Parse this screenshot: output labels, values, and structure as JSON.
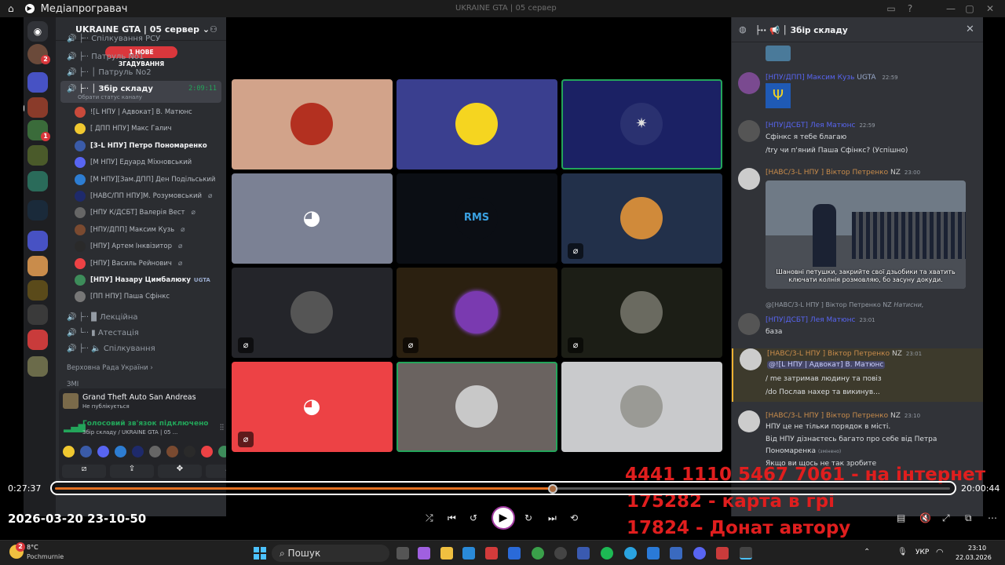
{
  "player": {
    "title": "Медіапрогравач",
    "center_title": "UKRAINE GTA | 05 сервер",
    "time_elapsed": "0:27:37",
    "time_total": "20:00:44",
    "progress": 0.5577,
    "timestamp_overlay": "2026-03-20 23-10-50"
  },
  "server": {
    "name": "UKRAINE GTA | 05 сервер",
    "mention_badge": "1 НОВЕ ЗГАДУВАННЯ",
    "channels_top": [
      {
        "label": "Спілкування РСУ"
      },
      {
        "label": "Патруль No1"
      },
      {
        "label": "Патруль No2"
      }
    ],
    "active_channel": {
      "label": "Збір складу",
      "status": "Обрати статус каналу",
      "timer": "2:09:11"
    },
    "voice_users": [
      {
        "name": "![L НПУ | Адвокат] В. Матюнс",
        "color": "#c94a3b"
      },
      {
        "name": "[ ДПП НПУ] Макс Галич",
        "color": "#f0c830"
      },
      {
        "name": "[3-L НПУ] Петро Пономаренко",
        "color": "#3a5ba8",
        "bold": true
      },
      {
        "name": "[М НПУ] Едуард Міхновський",
        "color": "#5865f2"
      },
      {
        "name": "[М НПУ][Зам.ДПП] Ден Подільський",
        "color": "#2d7dd2"
      },
      {
        "name": "[НАВС/ПП НПУ]М. Розумовський",
        "color": "#1e2a6b"
      },
      {
        "name": "[НПУ К/ДСБТ] Валерія Вест",
        "color": "#666666"
      },
      {
        "name": "[НПУ/ДПП] Максим Кузь",
        "color": "#7a4a30"
      },
      {
        "name": "[НПУ] Артем Інквізитор",
        "color": "#2a2a2a"
      },
      {
        "name": "[НПУ] Василь Рейнович",
        "color": "#ed4245"
      },
      {
        "name": "[НПУ] Назару Цимбалюку",
        "color": "#3d8c5a",
        "bold": true
      },
      {
        "name": "[ПП НПУ] Паша Сфінкс",
        "color": "#777777"
      }
    ],
    "channels_bottom": [
      {
        "label": "Лекційна"
      },
      {
        "label": "Атестація"
      },
      {
        "label": "Спілкування"
      }
    ],
    "categories": [
      {
        "label": "Верховна Рада України"
      },
      {
        "label": "ЗМІ"
      }
    ],
    "ugta_tag": "UGTA"
  },
  "activity": {
    "game": "Grand Theft Auto San Andreas",
    "sub": "Не публікується"
  },
  "voice_panel": {
    "status": "Голосовий зв'язок підключено",
    "channel": "Збір складу / UKRAINE GTA | 05 ..."
  },
  "chat": {
    "header": "Збір складу",
    "messages": [
      {
        "author": "[НПУ/ДПП] Максим Кузь",
        "tag": "UGTA",
        "time": "22:59",
        "lines": []
      },
      {
        "author": "[НПУ|ДСБТ] Лея Матюнс",
        "time": "22:59",
        "lines": [
          "Сфінкс я тебе благаю",
          "/try чи п'яний Паша Сфінкс? (Успішно)"
        ]
      },
      {
        "author": "[НАВС/3-L НПУ ] Віктор Петренко",
        "tag": "NZ",
        "time": "23:00",
        "lines": [],
        "caption": "Шановні петушки, закрийте свої дзьобики та хватить ключати колнія розмовляю, бо засуну докуди."
      },
      {
        "author": "[НПУ|ДСБТ] Лея Матюнс",
        "time": "23:01",
        "reply": "@[НАВС/3-L НПУ ] Віктор Петренко",
        "reply_tag": "NZ",
        "reply_text": "Натисни,",
        "lines": [
          "база"
        ]
      },
      {
        "author": "[НАВС/3-L НПУ ] Віктор Петренко",
        "tag": "NZ",
        "time": "23:01",
        "mention": "@![L НПУ | Адвокат] В. Матюнс",
        "lines": [
          "/ me затримав людину та повіз",
          "/do Послав нахер та викинув..."
        ]
      },
      {
        "author": "[НАВС/3-L НПУ ] Віктор Петренко",
        "tag": "NZ",
        "time": "23:10",
        "lines": [
          "НПУ це не тільки порядок в місті.",
          "Від НПУ дізнаєтесь багато про себе від Петра",
          "Пономаренка",
          "Якщо ви щось не так зробите"
        ],
        "edited": "(змінено)"
      }
    ]
  },
  "overlay": {
    "line1": "4441 1110 5467 7061 - на інтернет",
    "line2": "175282 - карта в грі",
    "line3": "17824 - Донат автору"
  },
  "taskbar": {
    "weather_temp": "8°C",
    "weather_place": "Pochmurnie",
    "search": "Пошук",
    "lang": "УКР",
    "time": "23:10",
    "date": "22.03.2026",
    "badge": "2"
  },
  "colors": {
    "accent": "#5865f2",
    "green": "#23a55a",
    "red": "#da373c",
    "seek": "#e37022"
  }
}
